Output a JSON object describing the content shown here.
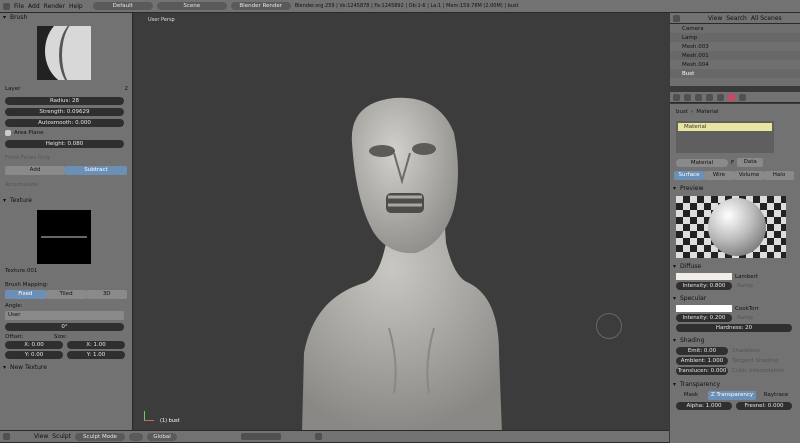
{
  "top_header": {
    "menus": [
      "File",
      "Add",
      "Render",
      "Help"
    ],
    "layout": "Default",
    "scene": "Scene",
    "engine": "Blender Render",
    "info": "Blender.org 259 | Ve:1245878 | Fa:1245892 | Ob:1-6 | La:1 | Mem:159.78M (2.00M) | bust"
  },
  "left": {
    "brush_title": "Brush",
    "layer_label": "Layer",
    "layer_value": "2",
    "radius": "Radius: 28",
    "strength": "Strength: 0.09629",
    "autosmooth": "Autosmooth: 0.000",
    "area_plane": "Area Plane",
    "height": "Height: 0.080",
    "front_faces": "Front Faces Only",
    "add": "Add",
    "subtract": "Subtract",
    "accumulate": "Accumulate",
    "texture_title": "Texture",
    "texture_name": "Texture.001",
    "brush_mapping": "Brush Mapping:",
    "mapping_opts": [
      "Fixed",
      "Tiled",
      "3D"
    ],
    "angle_label": "Angle:",
    "angle_mode": "User",
    "angle_value": "0°",
    "offset_label": "Offset:",
    "size_label": "Size:",
    "offset_x": "X: 0.00",
    "offset_y": "Y: 0.00",
    "size_x": "X: 1.00",
    "size_y": "Y: 1.00",
    "new_texture": "New Texture"
  },
  "viewport": {
    "label": "User Persp",
    "object_label": "(1) bust",
    "view": "View",
    "sculpt": "Sculpt",
    "mode": "Sculpt Mode",
    "global": "Global"
  },
  "outliner": {
    "menus": [
      "View",
      "Search",
      "All Scenes"
    ],
    "items": [
      "Camera",
      "Lamp",
      "Mesh.003",
      "Mesh.001",
      "Mesh.004",
      "Bust"
    ]
  },
  "props": {
    "breadcrumb_obj": "bust",
    "breadcrumb_mat": "Material",
    "slot": "Material",
    "mat_name": "Material",
    "mat_count": "F",
    "data": "Data",
    "tabs": [
      "Surface",
      "Wire",
      "Volume",
      "Halo"
    ],
    "preview": "Preview",
    "diffuse": "Diffuse",
    "diffuse_shader": "Lambert",
    "diffuse_intensity": "Intensity: 0.800",
    "ramp": "Ramp",
    "specular": "Specular",
    "spec_shader": "CookTorr",
    "spec_intensity": "Intensity: 0.200",
    "hardness": "Hardness: 20",
    "shading": "Shading",
    "emit": "Emit: 0.00",
    "ambient": "Ambient: 1.000",
    "translucency": "Translucen: 0.000",
    "shadeless": "Shadeless",
    "tangent": "Tangent Shading",
    "cubic": "Cubic Interpolation",
    "transparency": "Transparency",
    "trans_opts": [
      "Mask",
      "Z Transparency",
      "Raytrace"
    ],
    "alpha": "Alpha: 1.000",
    "fresnel": "Fresnel: 0.000"
  },
  "colors": {
    "accent": "#6b8fb5",
    "panel": "#727272",
    "viewport": "#3a3a3a",
    "field": "#2f2f2f",
    "clay": "#b9b7b2"
  }
}
